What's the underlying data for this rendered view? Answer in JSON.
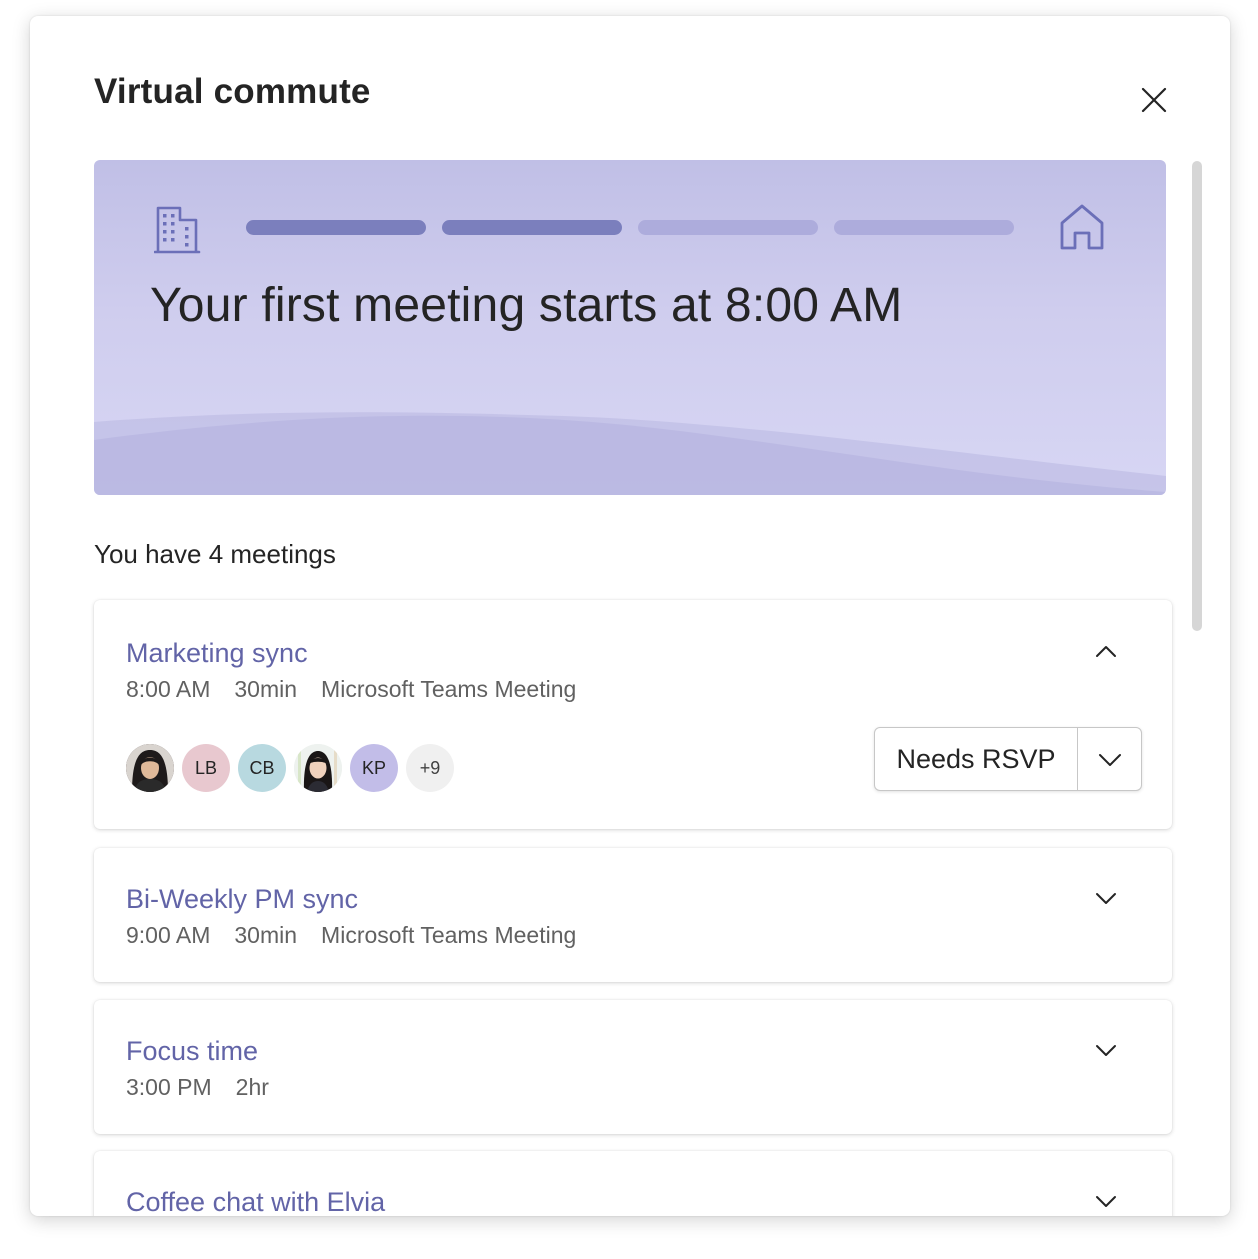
{
  "dialog": {
    "title": "Virtual commute",
    "close_icon": "close-icon"
  },
  "hero": {
    "start_icon": "building-icon",
    "end_icon": "home-icon",
    "progress_segments_total": 4,
    "progress_segments_filled": 2,
    "message": "Your first meeting starts at 8:00 AM",
    "colors": {
      "filled": "#7b7fbd",
      "empty": "#adacdc"
    }
  },
  "meetings": {
    "heading": "You have 4 meetings",
    "items": [
      {
        "title": "Marketing sync",
        "time": "8:00 AM",
        "duration": "30min",
        "location": "Microsoft Teams Meeting",
        "expanded": true,
        "chevron_icon": "chevron-up-icon",
        "attendees": [
          {
            "type": "photo",
            "name": "attendee-photo-1"
          },
          {
            "type": "initials",
            "initials": "LB",
            "color": "#e8c8cf"
          },
          {
            "type": "initials",
            "initials": "CB",
            "color": "#b8d9e0"
          },
          {
            "type": "photo",
            "name": "attendee-photo-2"
          },
          {
            "type": "initials",
            "initials": "KP",
            "color": "#c2bde8"
          }
        ],
        "more_attendees": "+9",
        "rsvp_label": "Needs RSVP",
        "rsvp_dropdown_icon": "chevron-down-icon"
      },
      {
        "title": "Bi-Weekly PM sync",
        "time": "9:00 AM",
        "duration": "30min",
        "location": "Microsoft Teams Meeting",
        "expanded": false,
        "chevron_icon": "chevron-down-icon"
      },
      {
        "title": "Focus time",
        "time": "3:00 PM",
        "duration": "2hr",
        "expanded": false,
        "chevron_icon": "chevron-down-icon"
      },
      {
        "title": "Coffee chat with Elvia",
        "expanded": false,
        "chevron_icon": "chevron-down-icon"
      }
    ]
  },
  "colors": {
    "accent": "#6264a7",
    "text_primary": "#242424",
    "text_secondary": "#616161"
  }
}
